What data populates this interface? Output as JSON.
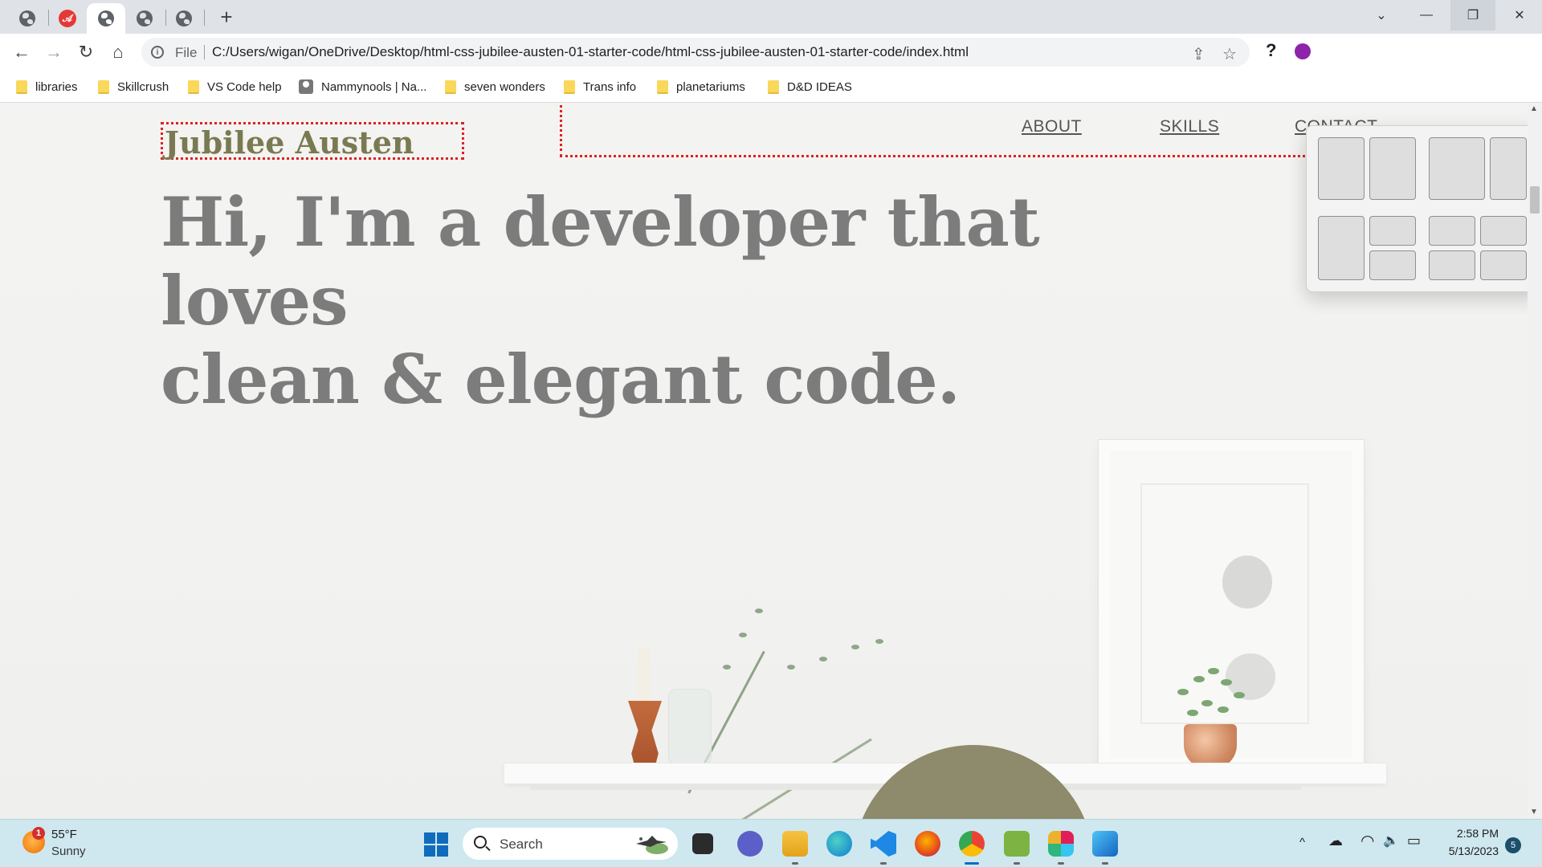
{
  "browser": {
    "tabs": [
      {
        "icon": "globe-icon"
      },
      {
        "icon": "pdf-icon",
        "glyph": "𝒜"
      },
      {
        "icon": "globe-icon",
        "active": true
      },
      {
        "icon": "globe-icon"
      },
      {
        "icon": "globe-icon"
      }
    ],
    "new_tab": "+",
    "window_controls": {
      "tab_search": "⌄",
      "minimize": "—",
      "restore": "❐",
      "close": "✕"
    },
    "toolbar": {
      "back": "←",
      "forward": "→",
      "reload": "↻",
      "home": "⌂"
    },
    "omnibox": {
      "scheme": "File",
      "url": "C:/Users/wigan/OneDrive/Desktop/html-css-jubilee-austen-01-starter-code/html-css-jubilee-austen-01-starter-code/index.html",
      "share": "⇪",
      "star": "☆",
      "help": "?"
    },
    "bookmarks": [
      {
        "label": "libraries",
        "icon": "folder-icon"
      },
      {
        "label": "Skillcrush",
        "icon": "folder-icon"
      },
      {
        "label": "VS Code help",
        "icon": "folder-icon"
      },
      {
        "label": "Nammynools | Na...",
        "icon": "site-favicon"
      },
      {
        "label": "seven wonders",
        "icon": "folder-icon"
      },
      {
        "label": "Trans info",
        "icon": "folder-icon"
      },
      {
        "label": "planetariums",
        "icon": "folder-icon"
      },
      {
        "label": "D&D IDEAS",
        "icon": "folder-icon"
      }
    ]
  },
  "page": {
    "logo": "Jubilee Austen",
    "nav": [
      "ABOUT",
      "SKILLS",
      "CONTACT"
    ],
    "hero_line1": "Hi, I'm a developer that loves",
    "hero_line2": "clean & elegant code."
  },
  "taskbar": {
    "weather": {
      "temp": "55°F",
      "condition": "Sunny",
      "badge": "1"
    },
    "search_label": "Search",
    "apps": [
      "task-view",
      "teams-chat",
      "file-explorer",
      "edge",
      "vs-code",
      "firefox",
      "chrome",
      "publisher",
      "slack",
      "paint"
    ],
    "tray": {
      "chevron": "^",
      "cloud": "☁",
      "wifi": "◠",
      "volume": "🔈",
      "battery": "▭"
    },
    "time": "2:58 PM",
    "date": "5/13/2023",
    "notifications": "5"
  },
  "colors": {
    "logo": "#7a7a52",
    "hero": "#7c7c7c",
    "debug_outline": "#dd2222",
    "taskbar": "#cfe8ef"
  }
}
